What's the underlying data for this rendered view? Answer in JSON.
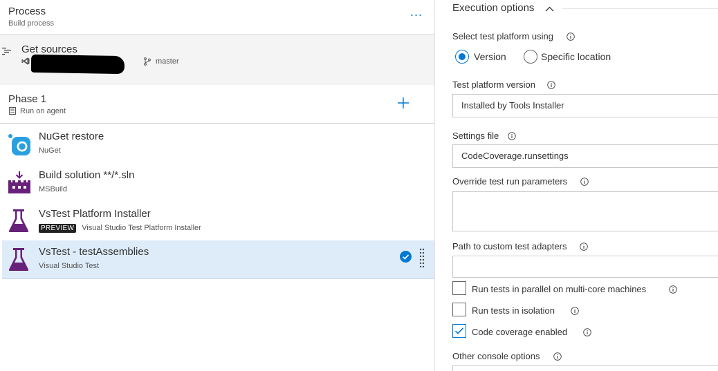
{
  "process": {
    "title": "Process",
    "subtitle": "Build process",
    "more_label": "..."
  },
  "get_sources": {
    "title": "Get sources",
    "branch": "master"
  },
  "phase": {
    "title": "Phase 1",
    "subtitle": "Run on agent",
    "add_label": "+"
  },
  "tasks": [
    {
      "title": "NuGet restore",
      "subtitle": "NuGet",
      "icon": "nuget-icon"
    },
    {
      "title": "Build solution **/*.sln",
      "subtitle": "MSBuild",
      "icon": "msbuild-icon"
    },
    {
      "title": "VsTest Platform Installer",
      "subtitle": "Visual Studio Test Platform Installer",
      "badge": "PREVIEW",
      "icon": "flask-icon"
    },
    {
      "title": "VsTest - testAssemblies",
      "subtitle": "Visual Studio Test",
      "icon": "flask-icon",
      "selected": true
    }
  ],
  "execution": {
    "section_title": "Execution options",
    "platform_label": "Select test platform using",
    "platform_options": [
      "Version",
      "Specific location"
    ],
    "platform_selected": "Version",
    "platform_version_label": "Test platform version",
    "platform_version_value": "Installed by Tools Installer",
    "settings_label": "Settings file",
    "settings_value": "CodeCoverage.runsettings",
    "override_label": "Override test run parameters",
    "override_value": "",
    "adapters_label": "Path to custom test adapters",
    "adapters_value": "",
    "checkboxes": [
      {
        "label": "Run tests in parallel on multi-core machines",
        "checked": false
      },
      {
        "label": "Run tests in isolation",
        "checked": false
      },
      {
        "label": "Code coverage enabled",
        "checked": true
      }
    ],
    "console_label": "Other console options"
  },
  "colors": {
    "accent": "#0078d4",
    "selected_row": "#deecf9",
    "nuget_blue": "#2aa0e0",
    "vs_purple": "#68217a"
  }
}
